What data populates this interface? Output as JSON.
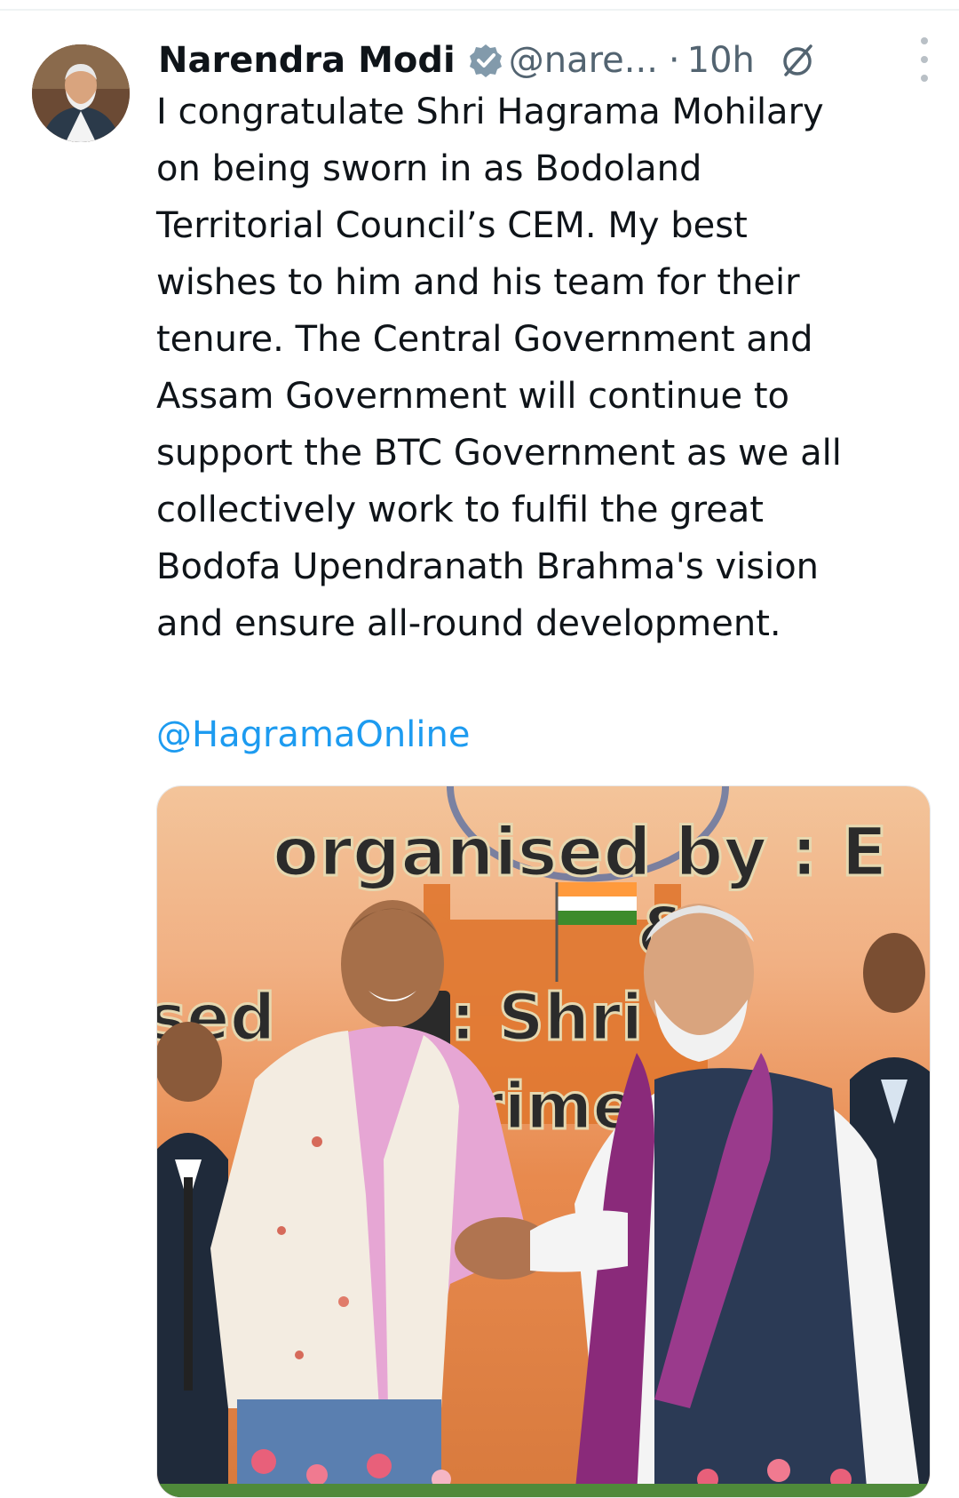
{
  "tweet": {
    "author_name": "Narendra Modi",
    "handle": "@nare...",
    "separator": "·",
    "time": "10h",
    "text": "I congratulate Shri Hagrama Mohilary\non being sworn in as Bodoland\nTerritorial Council’s CEM. My best\nwishes to him and his team for their\ntenure. The Central Government and\nAssam Government will continue to\nsupport the BTC Government as we all\ncollectively work to fulfil the great\nBodofa Upendranath Brahma's vision\nand ensure all-round development.",
    "mention": "@HagramaOnline"
  },
  "media": {
    "banner_line1": "organised by : E",
    "banner_amp": "&",
    "banner_line2_left": "sed",
    "banner_line2_right": ": Shri",
    "banner_line3": "rime"
  },
  "icons": {
    "verified": "verified-badge-icon",
    "grok": "no-circle-icon",
    "more": "more-vertical-icon"
  },
  "colors": {
    "accent": "#1d9bf0",
    "muted": "#536471",
    "text": "#0f1419"
  }
}
